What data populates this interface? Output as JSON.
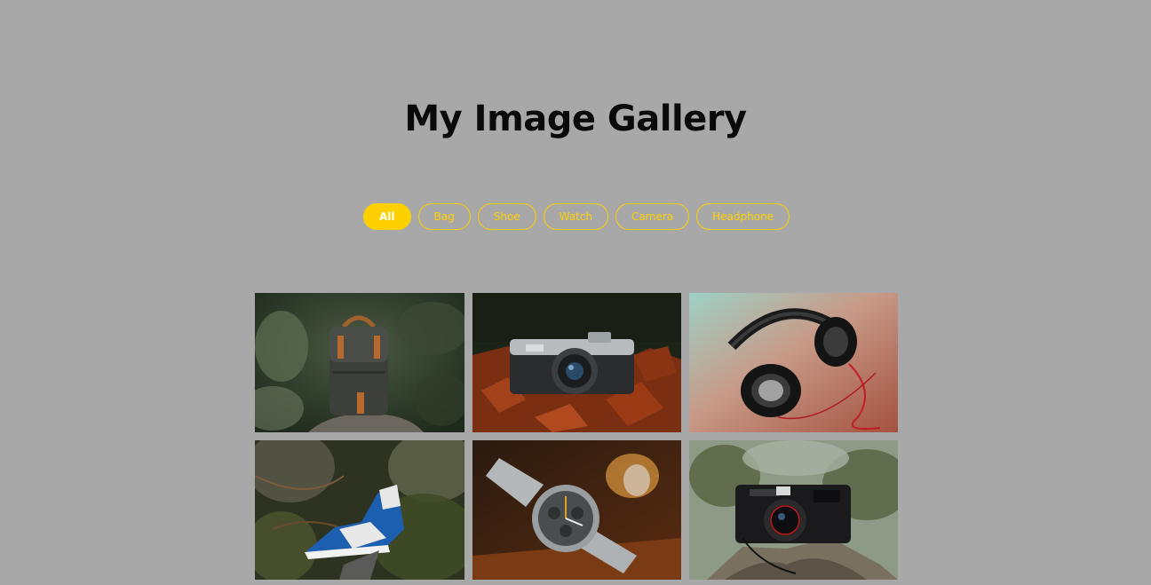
{
  "title": "My Image Gallery",
  "filters": [
    {
      "label": "All",
      "active": true
    },
    {
      "label": "Bag",
      "active": false
    },
    {
      "label": "Shoe",
      "active": false
    },
    {
      "label": "Watch",
      "active": false
    },
    {
      "label": "Camera",
      "active": false
    },
    {
      "label": "Headphone",
      "active": false
    }
  ],
  "accent_color": "#ffd000",
  "background_color": "#a8a8a8",
  "gallery": [
    {
      "category": "Bag",
      "subject": "backpack-photo"
    },
    {
      "category": "Camera",
      "subject": "camera-on-leaves-photo"
    },
    {
      "category": "Headphone",
      "subject": "headphones-photo"
    },
    {
      "category": "Shoe",
      "subject": "sneaker-photo"
    },
    {
      "category": "Watch",
      "subject": "wristwatch-photo"
    },
    {
      "category": "Camera",
      "subject": "yashica-camera-photo"
    }
  ]
}
